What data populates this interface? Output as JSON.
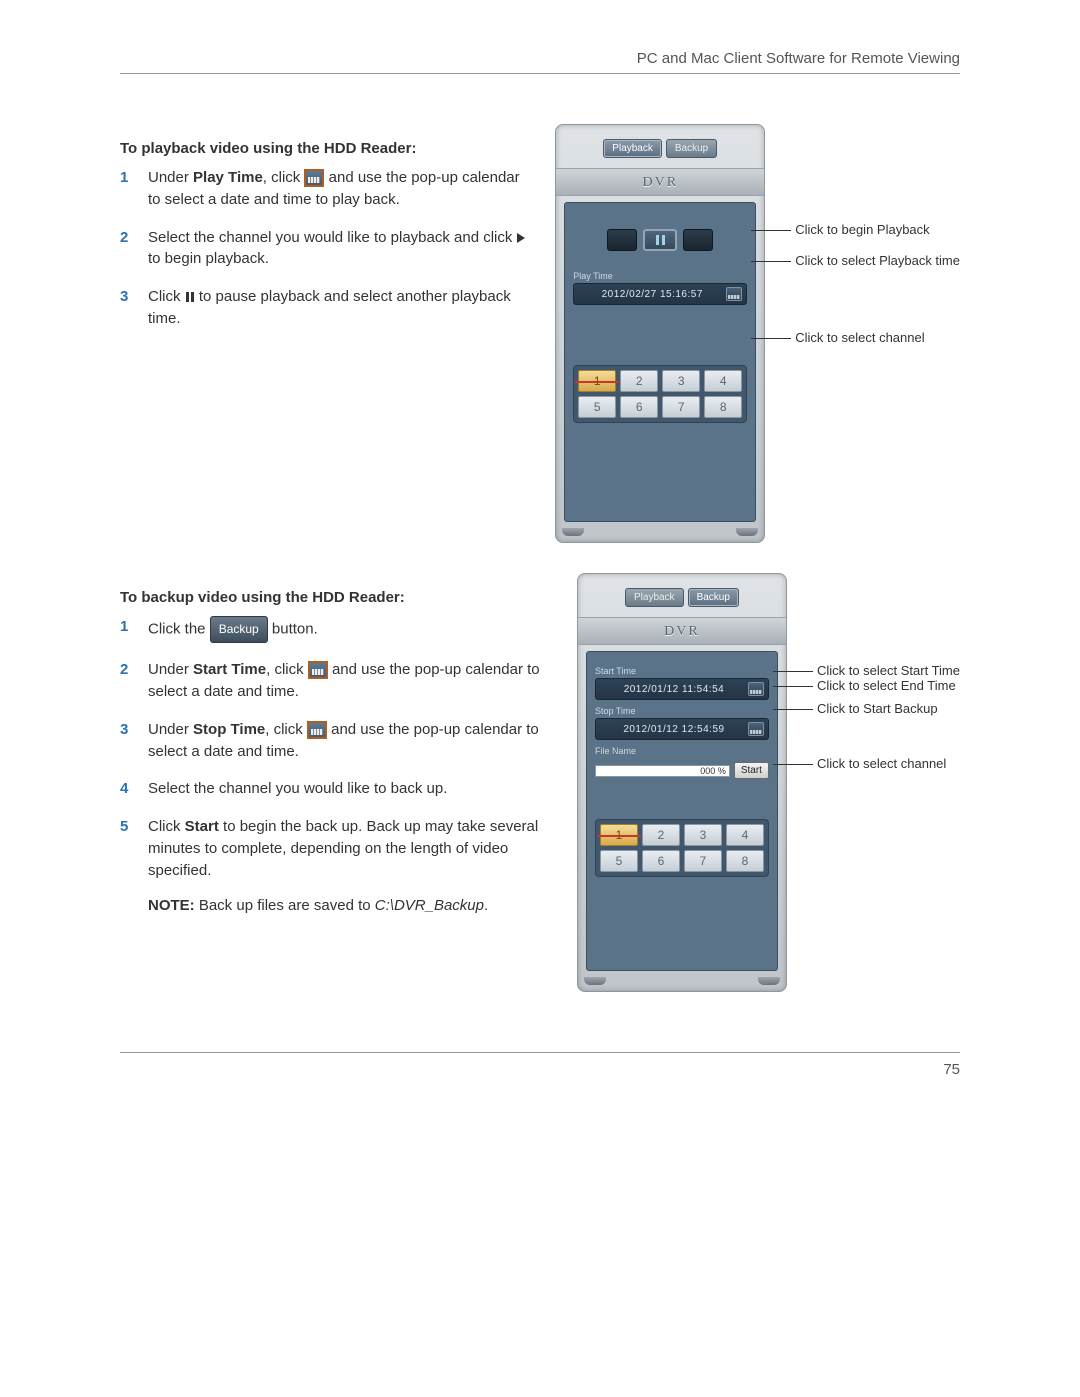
{
  "header": {
    "title": "PC and Mac Client Software for Remote Viewing"
  },
  "page_number": "75",
  "section1": {
    "heading": "To playback video using the HDD Reader:",
    "steps_parts": {
      "s1a": "Under ",
      "s1b": "Play Time",
      "s1c": ", click",
      "s1d": "and use the pop-up calendar to select a date and time to play back.",
      "s2a": "Select the channel you would like to playback and click",
      "s2b": "to begin playback.",
      "s3a": "Click",
      "s3b": "to pause playback and select another playback time."
    }
  },
  "section2": {
    "heading": "To backup video using the HDD Reader:",
    "steps_parts": {
      "s1a": "Click the",
      "s1b": "button.",
      "s2a": "Under ",
      "s2b": "Start Time",
      "s2c": ", click",
      "s2d": "and use the pop-up calendar to select a date and time.",
      "s3a": "Under ",
      "s3b": "Stop Time",
      "s3c": ", click",
      "s3d": "and use the pop-up calendar to select a date and time.",
      "s4": "Select the channel you would like to back up.",
      "s5a": "Click ",
      "s5b": "Start",
      "s5c": " to begin the back up. Back up may take several minutes to complete, depending on the length of video specified.",
      "note_label": "NOTE:",
      "note_a": " Back up files are saved to ",
      "note_path": "C:\\DVR_Backup",
      "note_b": "."
    }
  },
  "dvr1": {
    "tab_playback": "Playback",
    "tab_backup": "Backup",
    "logo": "DVR",
    "playtime_label": "Play Time",
    "playtime_value": "2012/02/27  15:16:57",
    "channels": [
      "1",
      "2",
      "3",
      "4",
      "5",
      "6",
      "7",
      "8"
    ],
    "callouts": {
      "c1": "Click to begin Playback",
      "c2": "Click to select Playback time",
      "c3": "Click to select channel"
    }
  },
  "dvr2": {
    "tab_playback": "Playback",
    "tab_backup": "Backup",
    "logo": "DVR",
    "starttime_label": "Start Time",
    "starttime_value": "2012/01/12  11:54:54",
    "stoptime_label": "Stop Time",
    "stoptime_value": "2012/01/12  12:54:59",
    "filename_label": "File Name",
    "progress_text": "000 %",
    "start_label": "Start",
    "channels": [
      "1",
      "2",
      "3",
      "4",
      "5",
      "6",
      "7",
      "8"
    ],
    "callouts": {
      "c1": "Click to select Start Time",
      "c2": "Click to select End Time",
      "c3": "Click to Start Backup",
      "c4": "Click to select channel"
    }
  },
  "inline": {
    "backup_chip": "Backup"
  }
}
